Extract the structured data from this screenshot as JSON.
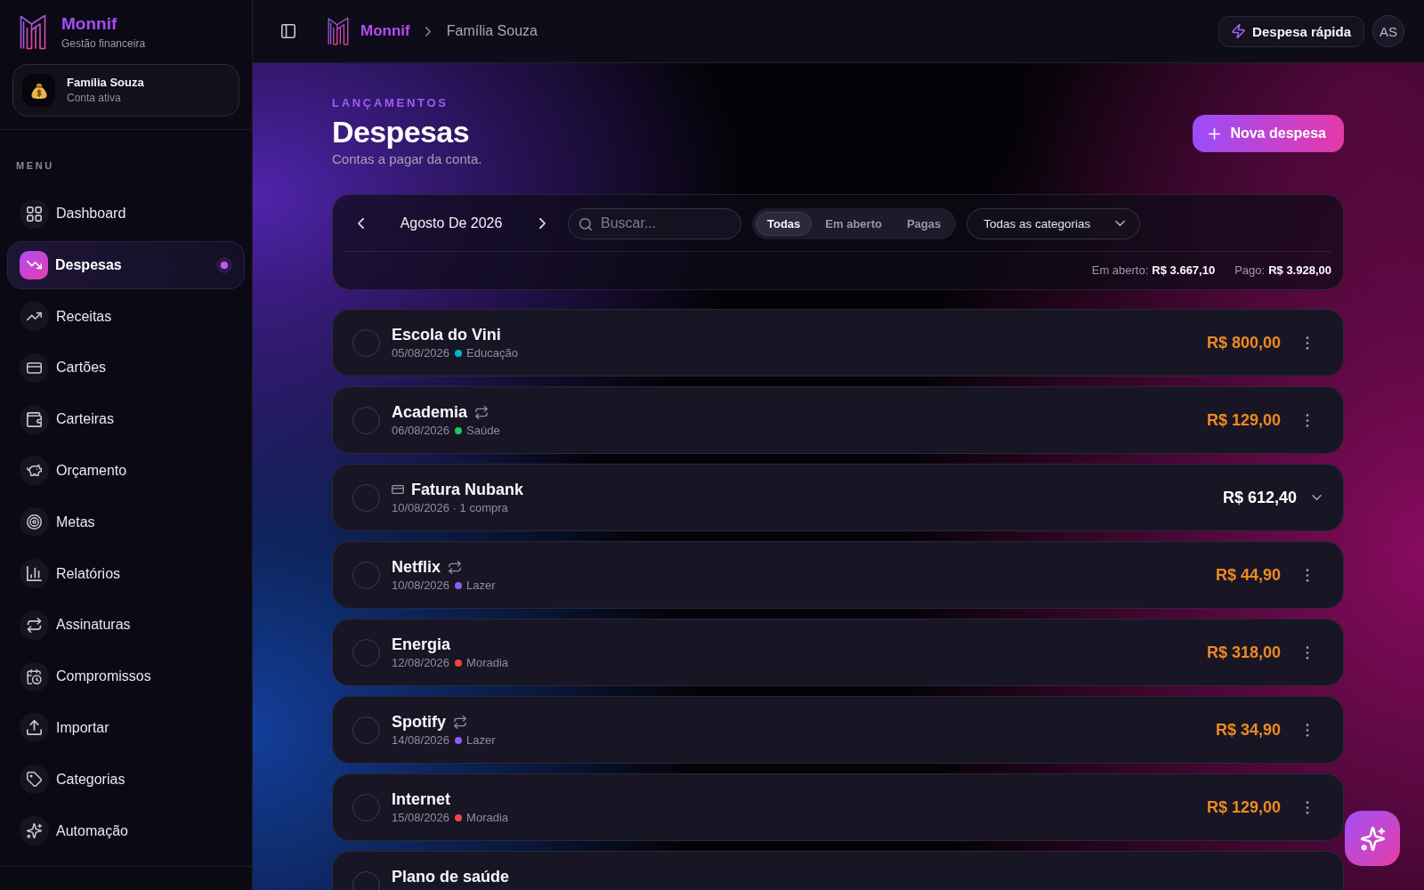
{
  "sidebar": {
    "brand": {
      "name": "Monnif",
      "tagline": "Gestão financeira"
    },
    "account": {
      "name": "Família Souza",
      "status": "Conta ativa"
    },
    "menu_label": "MENU",
    "items": [
      {
        "label": "Dashboard",
        "selected": false
      },
      {
        "label": "Despesas",
        "selected": true
      },
      {
        "label": "Receitas",
        "selected": false
      },
      {
        "label": "Cartões",
        "selected": false
      },
      {
        "label": "Carteiras",
        "selected": false
      },
      {
        "label": "Orçamento",
        "selected": false
      },
      {
        "label": "Metas",
        "selected": false
      },
      {
        "label": "Relatórios",
        "selected": false
      },
      {
        "label": "Assinaturas",
        "selected": false
      },
      {
        "label": "Compromissos",
        "selected": false
      },
      {
        "label": "Importar",
        "selected": false
      },
      {
        "label": "Categorias",
        "selected": false
      },
      {
        "label": "Automação",
        "selected": false
      }
    ]
  },
  "topbar": {
    "breadcrumb": [
      "Monnif",
      "Família Souza"
    ],
    "quick_action": "Despesa rápida",
    "avatar": "AS"
  },
  "header": {
    "eyebrow": "LANÇAMENTOS",
    "title": "Despesas",
    "subtitle": "Contas a pagar da conta.",
    "primary_button": "Nova despesa"
  },
  "filters": {
    "month": "Agosto De 2026",
    "search": {
      "placeholder": "Buscar..."
    },
    "status_tabs": [
      {
        "label": "Todas",
        "selected": true
      },
      {
        "label": "Em aberto",
        "selected": false
      },
      {
        "label": "Pagas",
        "selected": false
      }
    ],
    "category": "Todas as categorias",
    "summary": [
      {
        "label": "Em aberto:",
        "value": "R$ 3.667,10"
      },
      {
        "label": "Pago:",
        "value": "R$ 3.928,00"
      }
    ]
  },
  "expenses": [
    {
      "kind": "expense",
      "title": "Escola do Vini",
      "recurring": false,
      "date": "05/08/2026",
      "category": "Educação",
      "color": "#06b6d4",
      "amount": "R$ 800,00",
      "checked": false
    },
    {
      "kind": "expense",
      "title": "Academia",
      "recurring": true,
      "date": "06/08/2026",
      "category": "Saúde",
      "color": "#22c55e",
      "amount": "R$ 129,00",
      "checked": false
    },
    {
      "kind": "invoice",
      "title": "Fatura Nubank",
      "detail": "10/08/2026 · 1 compra",
      "amount": "R$ 612,40",
      "checked": false,
      "expanded": false
    },
    {
      "kind": "expense",
      "title": "Netflix",
      "recurring": true,
      "date": "10/08/2026",
      "category": "Lazer",
      "color": "#8b5cf6",
      "amount": "R$ 44,90",
      "checked": false
    },
    {
      "kind": "expense",
      "title": "Energia",
      "recurring": false,
      "date": "12/08/2026",
      "category": "Moradia",
      "color": "#ef4444",
      "amount": "R$ 318,00",
      "checked": false
    },
    {
      "kind": "expense",
      "title": "Spotify",
      "recurring": true,
      "date": "14/08/2026",
      "category": "Lazer",
      "color": "#8b5cf6",
      "amount": "R$ 34,90",
      "checked": false
    },
    {
      "kind": "expense",
      "title": "Internet",
      "recurring": false,
      "date": "15/08/2026",
      "category": "Moradia",
      "color": "#ef4444",
      "amount": "R$ 129,00",
      "checked": false
    },
    {
      "kind": "expense",
      "title": "Plano de saúde",
      "checked": false
    }
  ]
}
